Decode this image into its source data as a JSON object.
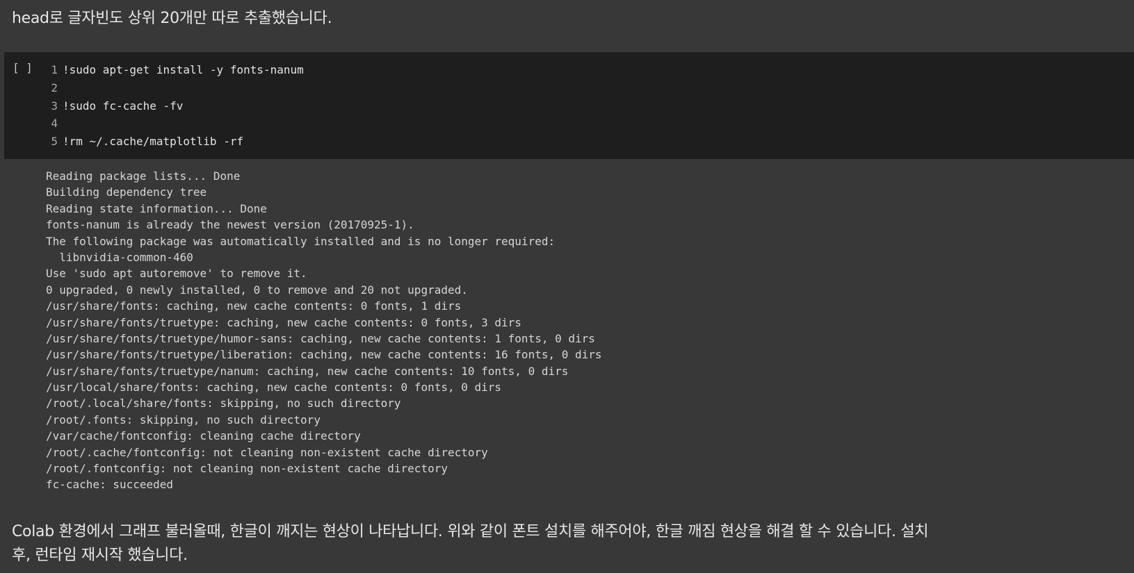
{
  "text_cell_top": "head로 글자빈도 상위 20개만 따로 추출했습니다.",
  "code_cell": {
    "run_indicator": "[ ]",
    "lines": [
      {
        "num": "1",
        "code": "!sudo apt-get install -y fonts-nanum"
      },
      {
        "num": "2",
        "code": ""
      },
      {
        "num": "3",
        "code": "!sudo fc-cache -fv"
      },
      {
        "num": "4",
        "code": ""
      },
      {
        "num": "5",
        "code": "!rm ~/.cache/matplotlib -rf"
      }
    ]
  },
  "output": [
    "Reading package lists... Done",
    "Building dependency tree",
    "Reading state information... Done",
    "fonts-nanum is already the newest version (20170925-1).",
    "The following package was automatically installed and is no longer required:",
    "  libnvidia-common-460",
    "Use 'sudo apt autoremove' to remove it.",
    "0 upgraded, 0 newly installed, 0 to remove and 20 not upgraded.",
    "/usr/share/fonts: caching, new cache contents: 0 fonts, 1 dirs",
    "/usr/share/fonts/truetype: caching, new cache contents: 0 fonts, 3 dirs",
    "/usr/share/fonts/truetype/humor-sans: caching, new cache contents: 1 fonts, 0 dirs",
    "/usr/share/fonts/truetype/liberation: caching, new cache contents: 16 fonts, 0 dirs",
    "/usr/share/fonts/truetype/nanum: caching, new cache contents: 10 fonts, 0 dirs",
    "/usr/local/share/fonts: caching, new cache contents: 0 fonts, 0 dirs",
    "/root/.local/share/fonts: skipping, no such directory",
    "/root/.fonts: skipping, no such directory",
    "/var/cache/fontconfig: cleaning cache directory",
    "/root/.cache/fontconfig: not cleaning non-existent cache directory",
    "/root/.fontconfig: not cleaning non-existent cache directory",
    "fc-cache: succeeded"
  ],
  "text_cell_bottom": {
    "line1": "Colab 환경에서 그래프 불러올때, 한글이 깨지는 현상이 나타납니다. 위와 같이 폰트 설치를 해주어야, 한글 깨짐 현상을 해결 할 수 있습니다. 설치",
    "line2": "후, 런타임 재시작 했습니다."
  }
}
